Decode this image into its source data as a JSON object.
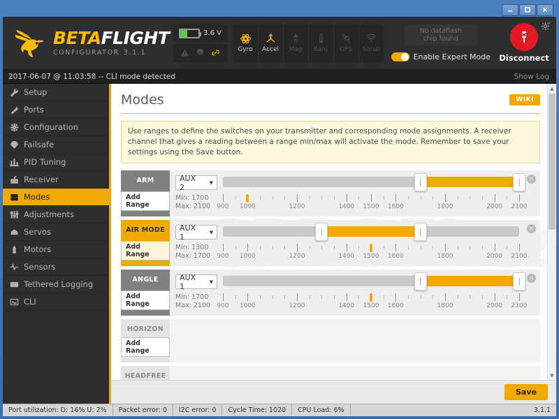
{
  "window": {
    "minimize_label": "minimize-icon",
    "maximize_label": "maximize-icon",
    "close_label": "close-icon"
  },
  "header": {
    "brand_beta": "BETA",
    "brand_flight": "FLIGHT",
    "brand_sub": "CONFIGURATOR",
    "version": "3.1.1",
    "battery": {
      "voltage": "3.6 V",
      "fill_percent": 38,
      "color": "#5cc94e"
    },
    "status_icons": [
      {
        "name": "warning-icon",
        "active": false
      },
      {
        "name": "parachute-icon",
        "active": false
      },
      {
        "name": "link-icon",
        "active": true
      }
    ],
    "sensors": [
      {
        "label": "Gyro",
        "icon": "gyro-icon",
        "active": true
      },
      {
        "label": "Accel",
        "icon": "accel-icon",
        "active": true
      },
      {
        "label": "Mag",
        "icon": "mag-icon",
        "active": false
      },
      {
        "label": "Baro",
        "icon": "baro-icon",
        "active": false
      },
      {
        "label": "GPS",
        "icon": "gps-icon",
        "active": false
      },
      {
        "label": "Sonar",
        "icon": "sonar-icon",
        "active": false
      }
    ],
    "dataflash_line1": "No dataflash",
    "dataflash_line2": "chip found",
    "expert_mode_label": "Enable Expert Mode",
    "expert_mode_on": true,
    "disconnect_label": "Disconnect",
    "accent": "#f0a900",
    "disconnect_color": "#e01b24"
  },
  "log": {
    "message": "2017-06-07 @ 11:03:58 -- CLI mode detected",
    "show_log_label": "Show Log"
  },
  "sidebar": {
    "items": [
      {
        "label": "Setup",
        "icon": "wrench-icon",
        "active": false
      },
      {
        "label": "Ports",
        "icon": "plug-icon",
        "active": false
      },
      {
        "label": "Configuration",
        "icon": "gear-icon",
        "active": false
      },
      {
        "label": "Failsafe",
        "icon": "parachute-icon",
        "active": false
      },
      {
        "label": "PID Tuning",
        "icon": "sliders-icon",
        "active": false
      },
      {
        "label": "Receiver",
        "icon": "receiver-icon",
        "active": false
      },
      {
        "label": "Modes",
        "icon": "modes-icon",
        "active": true
      },
      {
        "label": "Adjustments",
        "icon": "faders-icon",
        "active": false
      },
      {
        "label": "Servos",
        "icon": "servo-icon",
        "active": false
      },
      {
        "label": "Motors",
        "icon": "motor-icon",
        "active": false
      },
      {
        "label": "Sensors",
        "icon": "wave-icon",
        "active": false
      },
      {
        "label": "Tethered Logging",
        "icon": "log-icon",
        "active": false
      },
      {
        "label": "CLI",
        "icon": "terminal-icon",
        "active": false
      }
    ]
  },
  "main": {
    "title": "Modes",
    "wiki_label": "WIKI",
    "note": "Use ranges to define the switches on your transmitter and corresponding mode assignments. A receiver channel that gives a reading between a range min/max will activate the mode. Remember to save your settings using the Save button.",
    "watermark": "RCPROFI.cz",
    "add_range_label": "Add Range",
    "scale": {
      "min": 900,
      "max": 2100,
      "major_ticks": [
        900,
        1000,
        1200,
        1400,
        1500,
        1600,
        1800,
        2000,
        2100
      ],
      "minor_step": 50
    },
    "rows": [
      {
        "name": "ARM",
        "state": "inactive",
        "has_range": true,
        "channel": "AUX 2",
        "min_label": "Min: 1700",
        "max_label": "Max: 2100",
        "min": 1700,
        "max": 2100,
        "channel_value": 1000,
        "close_label": "×"
      },
      {
        "name": "AIR MODE",
        "state": "active",
        "has_range": true,
        "channel": "AUX 1",
        "min_label": "Min: 1300",
        "max_label": "Max: 1700",
        "min": 1300,
        "max": 1700,
        "channel_value": 1500,
        "close_label": "×"
      },
      {
        "name": "ANGLE",
        "state": "inactive",
        "has_range": true,
        "channel": "AUX 1",
        "min_label": "Min: 1700",
        "max_label": "Max: 2100",
        "min": 1700,
        "max": 2100,
        "channel_value": 1500,
        "close_label": "×"
      },
      {
        "name": "HORIZON",
        "state": "empty",
        "has_range": false
      },
      {
        "name": "HEADFREE",
        "state": "empty",
        "has_range": false
      }
    ],
    "save_label": "Save"
  },
  "statusbar": {
    "cells": [
      "Port utilization: D: 16% U: 2%",
      "Packet error: 0",
      "I2C error: 0",
      "Cycle Time: 1020",
      "CPU Load: 6%"
    ],
    "version": "3.1.1"
  }
}
